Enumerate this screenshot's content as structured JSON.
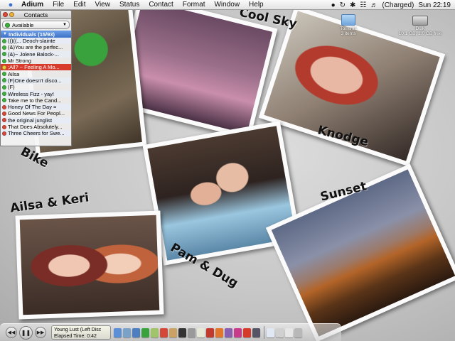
{
  "menubar": {
    "apple_icon": "apple-icon",
    "items": [
      "Adium",
      "File",
      "Edit",
      "View",
      "Status",
      "Contact",
      "Format",
      "Window",
      "Help"
    ],
    "battery_status": "(Charged)",
    "clock": "Sun 22:19"
  },
  "contacts": {
    "title": "Contacts",
    "status": "Available",
    "group_label": "Individuals (15/93)",
    "rows": [
      {
        "name": "(()((... Deoch-slainte",
        "color": "#3fb13f"
      },
      {
        "name": "(&)You are the perfec...",
        "color": "#3fb13f"
      },
      {
        "name": "(&)~ Jolene Balock-...",
        "color": "#3fb13f"
      },
      {
        "name": "Mr Strong",
        "color": "#3fb13f"
      },
      {
        "name": ";All? ~ Feeling A Mo...",
        "color": "#e8d43a"
      },
      {
        "name": "Ailsa",
        "color": "#3fb13f"
      },
      {
        "name": "(F)One doesn't disco...",
        "color": "#3fb13f"
      },
      {
        "name": "(F)",
        "color": "#3fb13f"
      },
      {
        "name": "Wireless Fizz - yay!",
        "color": "#3fb13f"
      },
      {
        "name": "Take me to the Cand...",
        "color": "#3fb13f"
      },
      {
        "name": "Honey Of The Day =",
        "color": "#d84a3a"
      },
      {
        "name": "Good News For Peopl...",
        "color": "#d84a3a"
      },
      {
        "name": "the original junglist",
        "color": "#d84a3a"
      },
      {
        "name": "That Does Absolutely...",
        "color": "#d84a3a"
      },
      {
        "name": "Three Cheers for Swe...",
        "color": "#d84a3a"
      }
    ]
  },
  "desktop_icons": {
    "torrents": {
      "label": "Torrents",
      "sub": "3 items"
    },
    "disk": {
      "label": "Disk",
      "sub": "10.1 GB, 1.0 GB free"
    }
  },
  "captions": {
    "cool_sky": "Cool Sky",
    "knodge": "Knodge",
    "bike": "Bike",
    "ailsa_keri": "Ailsa & Keri",
    "pam_dug": "Pam & Dug",
    "sunset": "Sunset"
  },
  "dock": {
    "track": "Young Lust (Left Disc",
    "elapsed": "Elapsed Time: 0:42",
    "prev_icon": "rewind-icon",
    "play_icon": "pause-icon",
    "next_icon": "fast-forward-icon"
  }
}
